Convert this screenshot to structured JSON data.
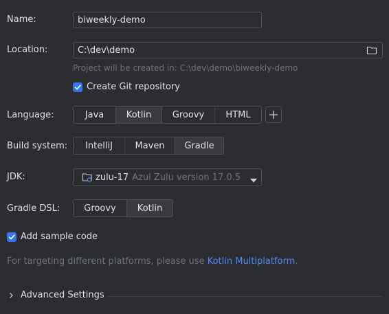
{
  "name": {
    "label": "Name:",
    "value": "biweekly-demo"
  },
  "location": {
    "label": "Location:",
    "value": "C:\\dev\\demo",
    "hint": "Project will be created in: C:\\dev\\demo\\biweekly-demo",
    "folder_icon": "folder-icon"
  },
  "git": {
    "label": "Create Git repository",
    "checked": true
  },
  "language": {
    "label": "Language:",
    "options": [
      "Java",
      "Kotlin",
      "Groovy",
      "HTML"
    ],
    "selected": "Kotlin",
    "add_icon": "plus-icon"
  },
  "build_system": {
    "label": "Build system:",
    "options": [
      "IntelliJ",
      "Maven",
      "Gradle"
    ],
    "selected": "Gradle"
  },
  "jdk": {
    "label": "JDK:",
    "name": "zulu-17",
    "detail": "Azul Zulu version 17.0.5",
    "icon": "folder-jdk-icon"
  },
  "gradle_dsl": {
    "label": "Gradle DSL:",
    "options": [
      "Groovy",
      "Kotlin"
    ],
    "selected": "Kotlin"
  },
  "sample_code": {
    "label": "Add sample code",
    "checked": true
  },
  "multiplatform": {
    "text": "For targeting different platforms, please use ",
    "link": "Kotlin Multiplatform",
    "suffix": "."
  },
  "advanced": {
    "label": "Advanced Settings"
  },
  "colors": {
    "background": "#2b2d30",
    "accent": "#3574f0",
    "link": "#548af7",
    "border": "#4e5157",
    "selected_segment": "#393b40"
  }
}
